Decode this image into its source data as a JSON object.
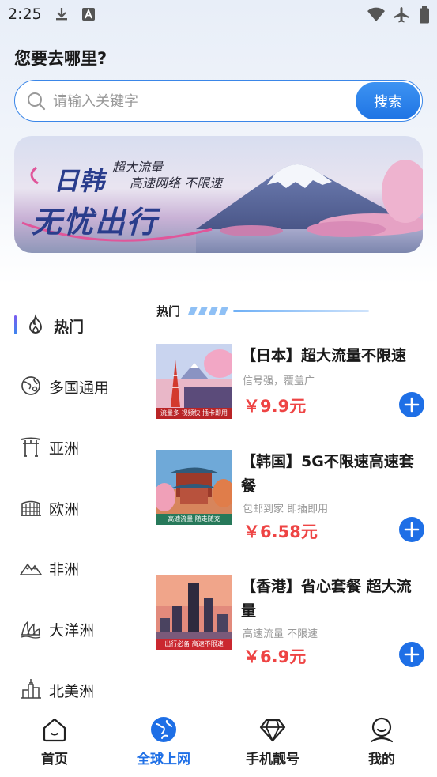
{
  "status_bar": {
    "time": "2:25"
  },
  "header": {
    "title": "您要去哪里?"
  },
  "search": {
    "placeholder": "请输入关键字",
    "button_label": "搜索"
  },
  "banner": {
    "title_line1": "日韩",
    "title_line2": "无忧出行",
    "subtitle_line1": "超大流量",
    "subtitle_line2": "高速网络 不限速"
  },
  "sidebar": {
    "items": [
      {
        "label": "热门",
        "icon": "flame-icon",
        "active": true
      },
      {
        "label": "多国通用",
        "icon": "globe-pin-icon"
      },
      {
        "label": "亚洲",
        "icon": "torii-gate-icon"
      },
      {
        "label": "欧洲",
        "icon": "colosseum-icon"
      },
      {
        "label": "非洲",
        "icon": "mountains-icon"
      },
      {
        "label": "大洋洲",
        "icon": "opera-house-icon"
      },
      {
        "label": "北美洲",
        "icon": "city-tower-icon"
      }
    ]
  },
  "section": {
    "title": "热门"
  },
  "products": [
    {
      "title": "【日本】超大流量不限速",
      "subtitle": "信号强，覆盖广",
      "price": "￥9.9元",
      "image_caption": "流量多 视频快 插卡即用"
    },
    {
      "title": "【韩国】5G不限速高速套餐",
      "subtitle": "包邮到家 即插即用",
      "price": "￥6.58元",
      "image_caption": "高速流量 随走随充"
    },
    {
      "title": "【香港】省心套餐 超大流量",
      "subtitle": "高速流量 不限速",
      "price": "￥6.9元",
      "image_caption": "出行必备 高速不限速"
    }
  ],
  "bottom_nav": {
    "items": [
      {
        "label": "首页",
        "icon": "home-icon"
      },
      {
        "label": "全球上网",
        "icon": "globe-icon",
        "active": true
      },
      {
        "label": "手机靓号",
        "icon": "diamond-icon"
      },
      {
        "label": "我的",
        "icon": "user-icon"
      }
    ]
  },
  "colors": {
    "accent": "#1e6fe6",
    "price": "#ee4444",
    "sidebar_active_bar": "#7a5cf0"
  }
}
